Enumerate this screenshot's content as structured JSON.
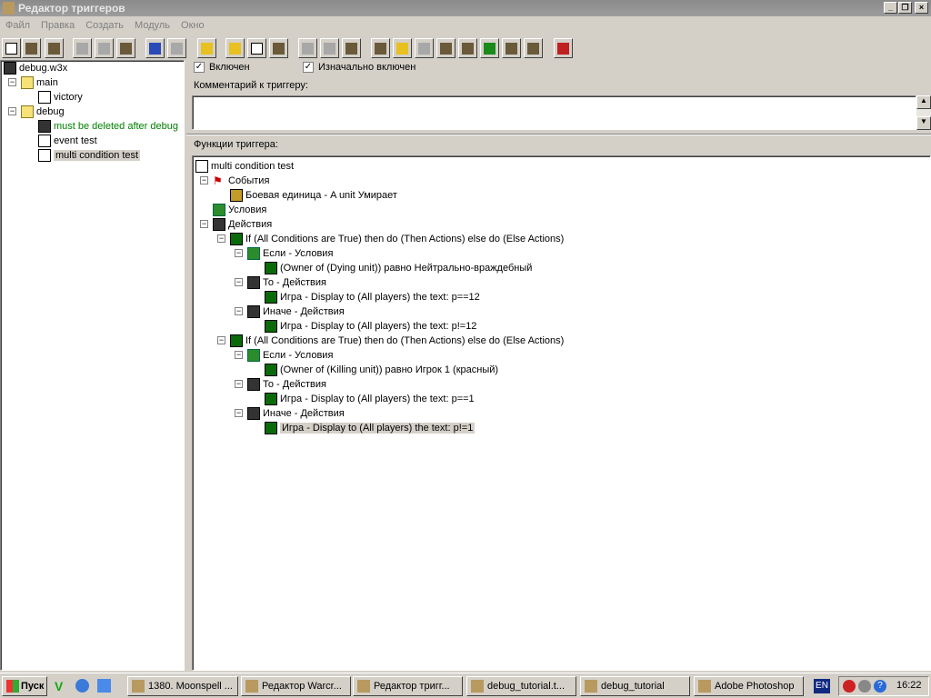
{
  "window": {
    "title": "Редактор триггеров"
  },
  "menu": [
    "Файл",
    "Правка",
    "Создать",
    "Модуль",
    "Окно"
  ],
  "toolbar": [
    "new-icon",
    "open-icon",
    "save-icon",
    "cut-icon",
    "copy-icon",
    "paste-icon",
    "undo-icon",
    "redo-icon",
    "delete-icon",
    "new-category-icon",
    "new-trigger-icon",
    "new-comment-icon",
    "new-event-icon",
    "new-condition-icon",
    "new-action-icon",
    "terrain-icon",
    "text-icon",
    "sound-icon",
    "object-icon",
    "ai-icon",
    "unit-icon",
    "campaign-icon",
    "import-icon",
    "test-map-icon"
  ],
  "left_tree": [
    {
      "label": "debug.w3x",
      "level": 0,
      "icon": "map-icon"
    },
    {
      "label": "main",
      "level": 1,
      "icon": "folder-icon",
      "expander": "−"
    },
    {
      "label": "victory",
      "level": 2,
      "icon": "trigger-icon"
    },
    {
      "label": "debug",
      "level": 1,
      "icon": "folder-icon",
      "expander": "−"
    },
    {
      "label": "must be deleted after debug",
      "level": 2,
      "icon": "comment-icon",
      "color": "#008000"
    },
    {
      "label": "event test",
      "level": 2,
      "icon": "trigger-icon"
    },
    {
      "label": "multi condition test",
      "level": 2,
      "icon": "trigger-icon",
      "selected": true
    }
  ],
  "enabled": {
    "label": "Включен",
    "checked": true
  },
  "initially_on": {
    "label": "Изначально включен",
    "checked": true
  },
  "comment_label": "Комментарий к триггеру:",
  "comment_value": "",
  "functions_label": "Функции триггера:",
  "func_tree": [
    {
      "label": "multi condition test",
      "level": 0,
      "icon": "trigger-icon"
    },
    {
      "label": "События",
      "level": 1,
      "icon": "event-flag-icon",
      "expander": "−"
    },
    {
      "label": "Боевая единица - A unit Умирает",
      "level": 2,
      "icon": "unit-event-icon"
    },
    {
      "label": "Условия",
      "level": 1,
      "icon": "conditions-icon"
    },
    {
      "label": "Действия",
      "level": 1,
      "icon": "actions-icon",
      "expander": "−"
    },
    {
      "label": "If (All Conditions are True) then do (Then Actions) else do (Else Actions)",
      "level": 2,
      "icon": "if-icon",
      "expander": "−"
    },
    {
      "label": "Если - Условия",
      "level": 3,
      "icon": "conditions-icon",
      "expander": "−"
    },
    {
      "label": "(Owner of (Dying unit)) равно Нейтрально-враждебный",
      "level": 4,
      "icon": "condition-icon"
    },
    {
      "label": "То - Действия",
      "level": 3,
      "icon": "actions-icon",
      "expander": "−"
    },
    {
      "label": "Игра - Display to (All players) the text: p==12",
      "level": 4,
      "icon": "game-action-icon"
    },
    {
      "label": "Иначе - Действия",
      "level": 3,
      "icon": "actions-icon",
      "expander": "−"
    },
    {
      "label": "Игра - Display to (All players) the text: p!=12",
      "level": 4,
      "icon": "game-action-icon"
    },
    {
      "label": "If (All Conditions are True) then do (Then Actions) else do (Else Actions)",
      "level": 2,
      "icon": "if-icon",
      "expander": "−"
    },
    {
      "label": "Если - Условия",
      "level": 3,
      "icon": "conditions-icon",
      "expander": "−"
    },
    {
      "label": "(Owner of (Killing unit)) равно Игрок 1 (красный)",
      "level": 4,
      "icon": "condition-icon"
    },
    {
      "label": "То - Действия",
      "level": 3,
      "icon": "actions-icon",
      "expander": "−"
    },
    {
      "label": "Игра - Display to (All players) the text: p==1",
      "level": 4,
      "icon": "game-action-icon"
    },
    {
      "label": "Иначе - Действия",
      "level": 3,
      "icon": "actions-icon",
      "expander": "−"
    },
    {
      "label": "Игра - Display to (All players) the text: p!=1",
      "level": 4,
      "icon": "game-action-icon",
      "selected": true
    }
  ],
  "taskbar": {
    "start": "Пуск",
    "tasks": [
      "1380. Moonspell ...",
      "Редактор Warcr...",
      "Редактор тригг...",
      "debug_tutorial.t...",
      "debug_tutorial",
      "Adobe Photoshop"
    ],
    "lang": "EN",
    "clock": "16:22"
  }
}
